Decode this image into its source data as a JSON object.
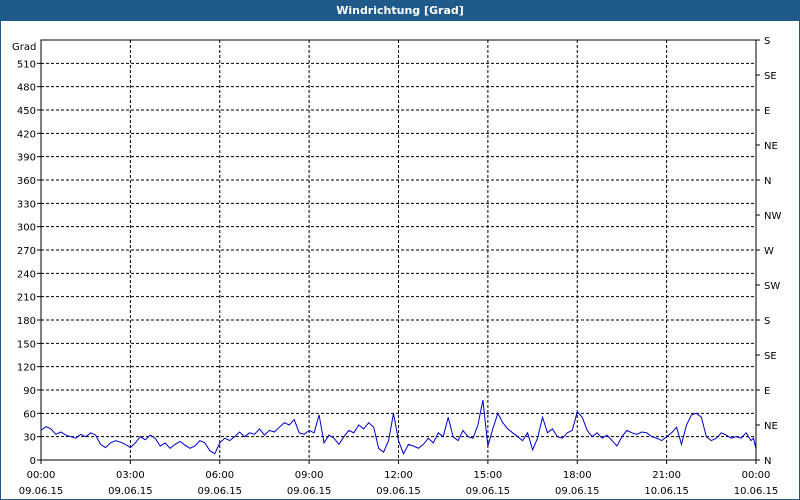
{
  "window": {
    "title": "Windrichtung [Grad]"
  },
  "chart_data": {
    "type": "line",
    "title": "Windrichtung [Grad]",
    "ylabel": "Grad",
    "ylim": [
      0,
      540
    ],
    "yticks": [
      0,
      30,
      60,
      90,
      120,
      150,
      180,
      210,
      240,
      270,
      300,
      330,
      360,
      390,
      420,
      450,
      480,
      510
    ],
    "right_axis_labels": [
      {
        "value": 0,
        "label": "N"
      },
      {
        "value": 45,
        "label": "NE"
      },
      {
        "value": 90,
        "label": "E"
      },
      {
        "value": 135,
        "label": "SE"
      },
      {
        "value": 180,
        "label": "S"
      },
      {
        "value": 225,
        "label": "SW"
      },
      {
        "value": 270,
        "label": "W"
      },
      {
        "value": 315,
        "label": "NW"
      },
      {
        "value": 360,
        "label": "N"
      },
      {
        "value": 405,
        "label": "NE"
      },
      {
        "value": 450,
        "label": "E"
      },
      {
        "value": 495,
        "label": "SE"
      },
      {
        "value": 540,
        "label": "S"
      }
    ],
    "xticks": [
      {
        "time": "00:00",
        "date": "09.06.15"
      },
      {
        "time": "03:00",
        "date": "09.06.15"
      },
      {
        "time": "06:00",
        "date": "09.06.15"
      },
      {
        "time": "09:00",
        "date": "09.06.15"
      },
      {
        "time": "12:00",
        "date": "09.06.15"
      },
      {
        "time": "15:00",
        "date": "09.06.15"
      },
      {
        "time": "18:00",
        "date": "09.06.15"
      },
      {
        "time": "21:00",
        "date": "10.06.15"
      },
      {
        "time": "00:00",
        "date": "10.06.15"
      }
    ],
    "grid": true,
    "series": [
      {
        "color": "#0000cc",
        "points": [
          [
            "00:00",
            38
          ],
          [
            "00:10",
            43
          ],
          [
            "00:20",
            40
          ],
          [
            "00:30",
            33
          ],
          [
            "00:40",
            36
          ],
          [
            "00:50",
            32
          ],
          [
            "01:00",
            30
          ],
          [
            "01:10",
            28
          ],
          [
            "01:20",
            33
          ],
          [
            "01:30",
            30
          ],
          [
            "01:40",
            35
          ],
          [
            "01:50",
            32
          ],
          [
            "02:00",
            20
          ],
          [
            "02:10",
            16
          ],
          [
            "02:20",
            22
          ],
          [
            "02:30",
            25
          ],
          [
            "02:40",
            23
          ],
          [
            "02:50",
            20
          ],
          [
            "03:00",
            16
          ],
          [
            "03:10",
            22
          ],
          [
            "03:20",
            30
          ],
          [
            "03:30",
            26
          ],
          [
            "03:40",
            32
          ],
          [
            "03:50",
            28
          ],
          [
            "04:00",
            18
          ],
          [
            "04:10",
            22
          ],
          [
            "04:20",
            15
          ],
          [
            "04:30",
            20
          ],
          [
            "04:40",
            24
          ],
          [
            "04:50",
            19
          ],
          [
            "05:00",
            15
          ],
          [
            "05:10",
            18
          ],
          [
            "05:20",
            25
          ],
          [
            "05:30",
            22
          ],
          [
            "05:40",
            12
          ],
          [
            "05:50",
            8
          ],
          [
            "06:00",
            22
          ],
          [
            "06:10",
            28
          ],
          [
            "06:20",
            25
          ],
          [
            "06:30",
            30
          ],
          [
            "06:40",
            36
          ],
          [
            "06:50",
            30
          ],
          [
            "07:00",
            35
          ],
          [
            "07:10",
            33
          ],
          [
            "07:20",
            40
          ],
          [
            "07:30",
            32
          ],
          [
            "07:40",
            38
          ],
          [
            "07:50",
            36
          ],
          [
            "08:00",
            42
          ],
          [
            "08:10",
            48
          ],
          [
            "08:20",
            45
          ],
          [
            "08:30",
            52
          ],
          [
            "08:40",
            35
          ],
          [
            "08:50",
            33
          ],
          [
            "09:00",
            38
          ],
          [
            "09:10",
            35
          ],
          [
            "09:20",
            58
          ],
          [
            "09:30",
            22
          ],
          [
            "09:40",
            32
          ],
          [
            "09:50",
            28
          ],
          [
            "10:00",
            20
          ],
          [
            "10:10",
            30
          ],
          [
            "10:20",
            38
          ],
          [
            "10:30",
            35
          ],
          [
            "10:40",
            45
          ],
          [
            "10:50",
            40
          ],
          [
            "11:00",
            48
          ],
          [
            "11:10",
            42
          ],
          [
            "11:20",
            15
          ],
          [
            "11:30",
            10
          ],
          [
            "11:40",
            25
          ],
          [
            "11:50",
            60
          ],
          [
            "12:00",
            25
          ],
          [
            "12:10",
            8
          ],
          [
            "12:20",
            20
          ],
          [
            "12:30",
            18
          ],
          [
            "12:40",
            15
          ],
          [
            "12:50",
            20
          ],
          [
            "13:00",
            28
          ],
          [
            "13:10",
            22
          ],
          [
            "13:20",
            35
          ],
          [
            "13:30",
            30
          ],
          [
            "13:40",
            55
          ],
          [
            "13:50",
            30
          ],
          [
            "14:00",
            25
          ],
          [
            "14:10",
            38
          ],
          [
            "14:20",
            30
          ],
          [
            "14:30",
            28
          ],
          [
            "14:40",
            45
          ],
          [
            "14:50",
            77
          ],
          [
            "15:00",
            18
          ],
          [
            "15:10",
            40
          ],
          [
            "15:20",
            60
          ],
          [
            "15:30",
            48
          ],
          [
            "15:40",
            40
          ],
          [
            "15:50",
            35
          ],
          [
            "16:00",
            30
          ],
          [
            "16:10",
            25
          ],
          [
            "16:20",
            35
          ],
          [
            "16:30",
            13
          ],
          [
            "16:40",
            28
          ],
          [
            "16:50",
            55
          ],
          [
            "17:00",
            35
          ],
          [
            "17:10",
            40
          ],
          [
            "17:20",
            30
          ],
          [
            "17:30",
            28
          ],
          [
            "17:40",
            35
          ],
          [
            "17:50",
            38
          ],
          [
            "18:00",
            62
          ],
          [
            "18:10",
            55
          ],
          [
            "18:20",
            38
          ],
          [
            "18:30",
            30
          ],
          [
            "18:40",
            35
          ],
          [
            "18:50",
            28
          ],
          [
            "19:00",
            32
          ],
          [
            "19:10",
            25
          ],
          [
            "19:20",
            18
          ],
          [
            "19:30",
            30
          ],
          [
            "19:40",
            38
          ],
          [
            "19:50",
            35
          ],
          [
            "20:00",
            33
          ],
          [
            "20:10",
            36
          ],
          [
            "20:20",
            35
          ],
          [
            "20:30",
            30
          ],
          [
            "20:40",
            28
          ],
          [
            "20:50",
            25
          ],
          [
            "21:00",
            30
          ],
          [
            "21:10",
            35
          ],
          [
            "21:20",
            42
          ],
          [
            "21:30",
            20
          ],
          [
            "21:40",
            45
          ],
          [
            "21:50",
            58
          ],
          [
            "22:00",
            60
          ],
          [
            "22:10",
            55
          ],
          [
            "22:20",
            30
          ],
          [
            "22:30",
            25
          ],
          [
            "22:40",
            28
          ],
          [
            "22:50",
            35
          ],
          [
            "23:00",
            32
          ],
          [
            "23:10",
            28
          ],
          [
            "23:20",
            30
          ],
          [
            "23:30",
            28
          ],
          [
            "23:40",
            35
          ],
          [
            "23:50",
            25
          ],
          [
            "23:55",
            28
          ],
          [
            "24:00",
            14
          ]
        ]
      }
    ]
  }
}
